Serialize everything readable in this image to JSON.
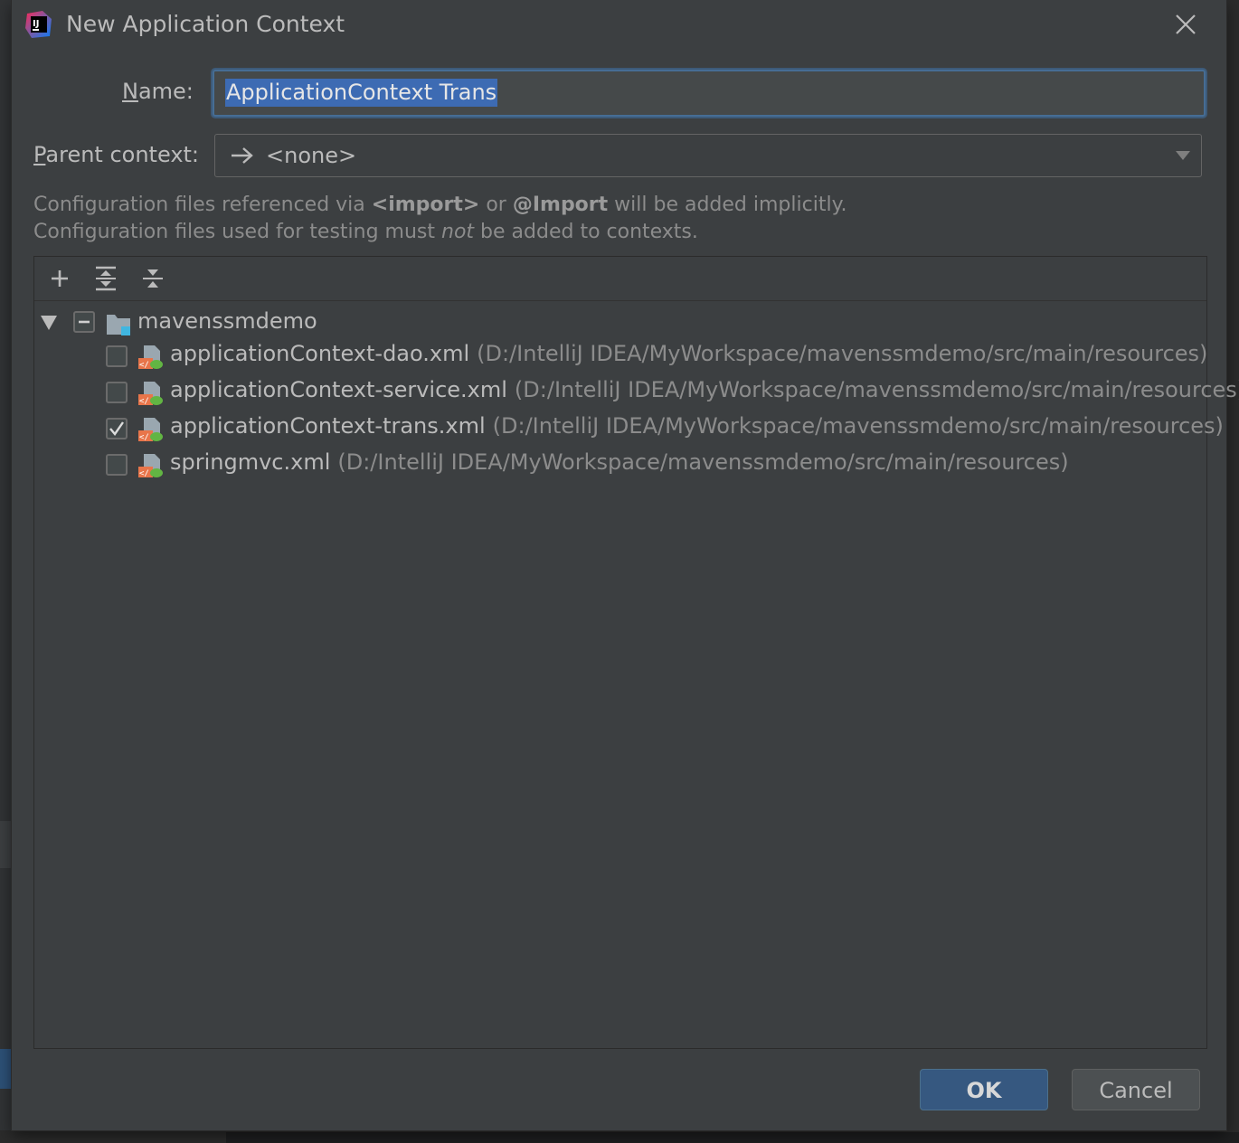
{
  "dialog": {
    "title": "New Application Context",
    "name_label_mnemonic": "N",
    "name_label_rest": "ame:",
    "name_value": "ApplicationContext Trans",
    "parent_label_mnemonic": "P",
    "parent_label_rest": "arent context:",
    "parent_value": "<none>",
    "info_line1": {
      "part1": "Configuration files referenced via ",
      "bold1": "<import>",
      "part2": " or ",
      "bold2": "@Import",
      "part3": " will be added implicitly."
    },
    "info_line2": {
      "part1": "Configuration files used for testing must ",
      "italic": "not",
      "part2": " be added to contexts."
    },
    "ok_label": "OK",
    "cancel_label": "Cancel"
  },
  "toolbar": {
    "icons": [
      "add-icon",
      "expand-all-icon",
      "collapse-all-icon"
    ]
  },
  "tree": {
    "root": {
      "name": "mavenssmdemo",
      "expanded": true,
      "state": "partial"
    },
    "files": [
      {
        "name": "applicationContext-dao.xml",
        "path": "(D:/IntelliJ IDEA/MyWorkspace/mavenssmdemo/src/main/resources)",
        "checked": false
      },
      {
        "name": "applicationContext-service.xml",
        "path": "(D:/IntelliJ IDEA/MyWorkspace/mavenssmdemo/src/main/resources)",
        "checked": false
      },
      {
        "name": "applicationContext-trans.xml",
        "path": "(D:/IntelliJ IDEA/MyWorkspace/mavenssmdemo/src/main/resources)",
        "checked": true
      },
      {
        "name": "springmvc.xml",
        "path": "(D:/IntelliJ IDEA/MyWorkspace/mavenssmdemo/src/main/resources)",
        "checked": false
      }
    ]
  },
  "colors": {
    "dialog_bg": "#3c3f41",
    "accent": "#365880",
    "focus_border": "#466d94",
    "selection": "#3d6bb3"
  }
}
